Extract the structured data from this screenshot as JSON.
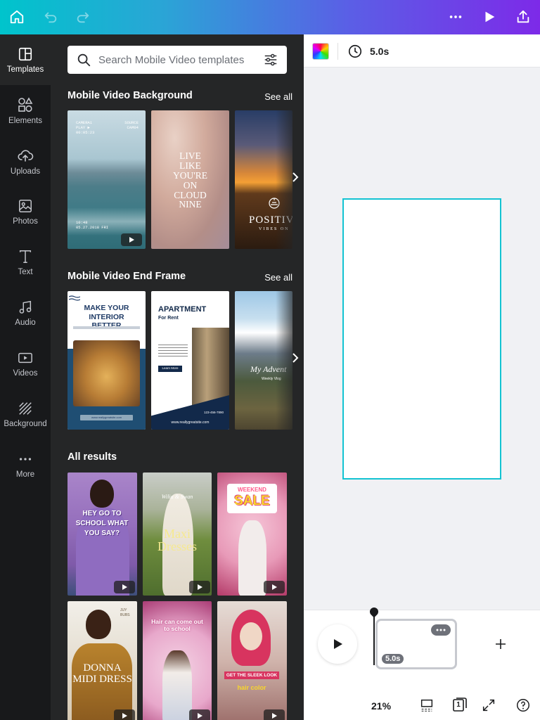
{
  "topbar": {
    "colors": {
      "start": "#00c4cc",
      "end": "#7d2ae8"
    }
  },
  "rail": [
    {
      "label": "Templates",
      "icon": "templates-icon"
    },
    {
      "label": "Elements",
      "icon": "elements-icon"
    },
    {
      "label": "Uploads",
      "icon": "uploads-icon"
    },
    {
      "label": "Photos",
      "icon": "photos-icon"
    },
    {
      "label": "Text",
      "icon": "text-icon"
    },
    {
      "label": "Audio",
      "icon": "audio-icon"
    },
    {
      "label": "Videos",
      "icon": "videos-icon"
    },
    {
      "label": "Background",
      "icon": "background-icon"
    },
    {
      "label": "More",
      "icon": "more-icon"
    }
  ],
  "search": {
    "placeholder": "Search Mobile Video templates"
  },
  "sections": {
    "background": {
      "title": "Mobile Video Background",
      "see_all": "See all"
    },
    "endframe": {
      "title": "Mobile Video End Frame",
      "see_all": "See all"
    },
    "results": {
      "title": "All results"
    }
  },
  "thumbs": {
    "bg1": {
      "top_left": "CAMERA1\nPLAY ▶\n00:05:23",
      "top_right": "SOURCE\nCAM04",
      "bottom": "10:48\n05.27.2018 FRI"
    },
    "bg2": {
      "text": "LIVE LIKE YOU'RE ON CLOUD NINE"
    },
    "bg3": {
      "text": "POSITIV",
      "sub": "VIBES ON"
    },
    "end1": {
      "title": "MAKE YOUR INTERIOR BETTER",
      "footer": "www.reallygreatsite.com"
    },
    "end2": {
      "title": "APARTMENT",
      "sub": "For Rent",
      "btn": "Learn More",
      "phone": "123-456-7890",
      "footer": "www.reallygreatsite.com"
    },
    "end3": {
      "text": "My Advent",
      "sub": "Weekly Vlog"
    },
    "r1": {
      "text": "HEY GO TO SCHOOL WHAT YOU SAY?"
    },
    "r2": {
      "brand": "Wilia & Swan",
      "text": "Maxi Dresses"
    },
    "r3": {
      "top": "WEEKEND",
      "text": "SALE"
    },
    "r4": {
      "badge": "JUY BUBS",
      "text": "DONNA MIDI DRESS"
    },
    "r5": {
      "text": "Hair can come out to school"
    },
    "r6": {
      "text": "GET THE SLEEK LOOK",
      "sub": "hair color"
    }
  },
  "editor": {
    "duration": "5.0s",
    "timeline": {
      "clip_duration": "5.0s"
    },
    "zoom": "21%",
    "pages": "1"
  }
}
